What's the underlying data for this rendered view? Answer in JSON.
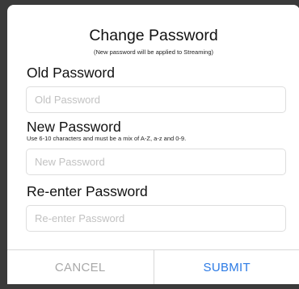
{
  "dialog": {
    "title": "Change Password",
    "subtitle": "(New password will be applied to Streaming)"
  },
  "old_password": {
    "label": "Old Password",
    "value": "",
    "placeholder": "Old Password"
  },
  "new_password": {
    "label": "New Password",
    "hint": "Use 6-10 characters and must be a mix of A-Z, a-z and 0-9.",
    "value": "",
    "placeholder": "New Password"
  },
  "reenter_password": {
    "label": "Re-enter Password",
    "value": "",
    "placeholder": "Re-enter Password"
  },
  "buttons": {
    "cancel": "CANCEL",
    "submit": "SUBMIT"
  },
  "colors": {
    "accent": "#2c7be5",
    "disabled": "#a8a8a8",
    "backdrop": "#3a3a3a"
  }
}
